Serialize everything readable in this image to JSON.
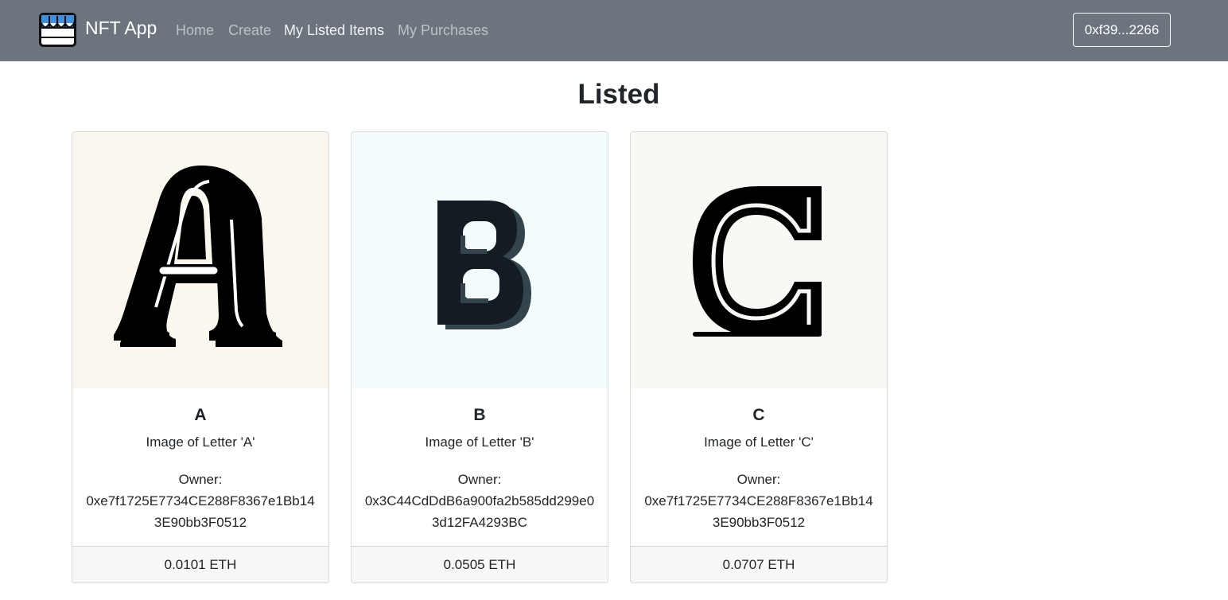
{
  "navbar": {
    "brand": "NFT App",
    "links": [
      "Home",
      "Create",
      "My Listed Items",
      "My Purchases"
    ],
    "active_link": "My Listed Items",
    "account": "0xf39...2266"
  },
  "page": {
    "title": "Listed"
  },
  "items": [
    {
      "name": "A",
      "description": "Image of Letter 'A'",
      "owner_label": "Owner:",
      "owner": "0xe7f1725E7734CE288F8367e1Bb143E90bb3F0512",
      "price": "0.0101 ETH",
      "image_bg": "#fbf7ee"
    },
    {
      "name": "B",
      "description": "Image of Letter 'B'",
      "owner_label": "Owner:",
      "owner": "0x3C44CdDdB6a900fa2b585dd299e03d12FA4293BC",
      "price": "0.0505 ETH",
      "image_bg": "#f3fbfd"
    },
    {
      "name": "C",
      "description": "Image of Letter 'C'",
      "owner_label": "Owner:",
      "owner": "0xe7f1725E7734CE288F8367e1Bb143E90bb3F0512",
      "price": "0.0707 ETH",
      "image_bg": "#f8f8f4"
    }
  ],
  "colors": {
    "navbar": "#6c757d",
    "text": "#212529",
    "footer": "#f7f7f7",
    "logo_blue": "#3f8fdc"
  },
  "icons": {
    "brand": "storefront-icon"
  }
}
